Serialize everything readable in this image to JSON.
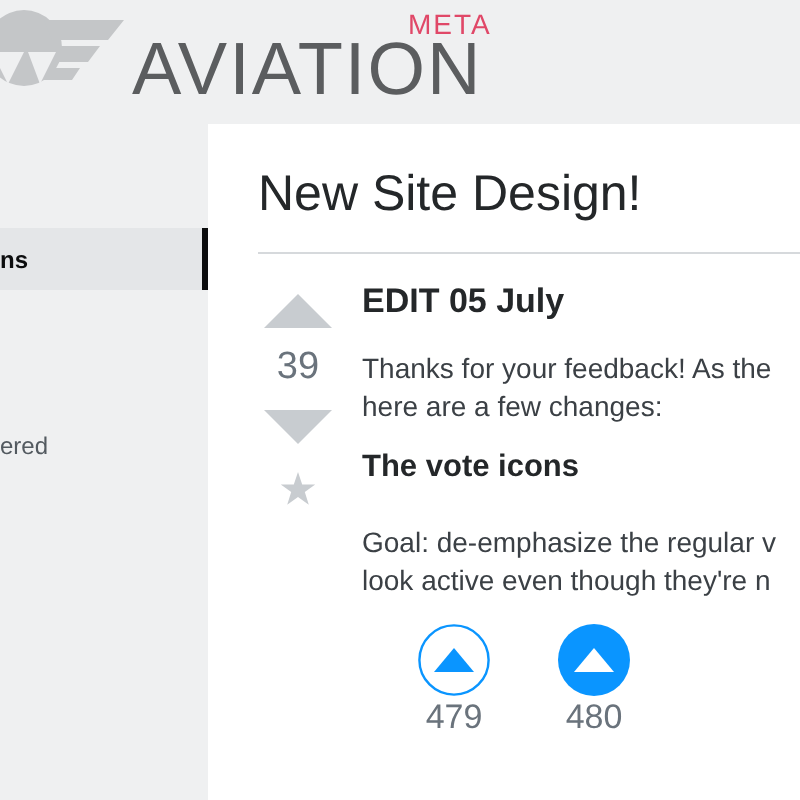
{
  "header": {
    "site": "AVIATION",
    "tag": "META"
  },
  "sidebar": {
    "items": [
      {
        "label": "ns",
        "selected": true
      },
      {
        "label": "ered",
        "selected": false
      }
    ]
  },
  "post": {
    "title": "New Site Design!",
    "vote": {
      "score": "39",
      "upvoted": false,
      "downvoted": false,
      "favorited": false
    },
    "heading": "EDIT 05 July",
    "intro_lines": [
      "Thanks for your feedback! As the",
      "here are a few changes:"
    ],
    "subheading": "The vote icons",
    "goal_lines": [
      "Goal: de-emphasize the regular v",
      "look active even though they're n"
    ],
    "samples": [
      {
        "kind": "outline",
        "count": "479"
      },
      {
        "kind": "filled",
        "count": "480"
      }
    ]
  }
}
